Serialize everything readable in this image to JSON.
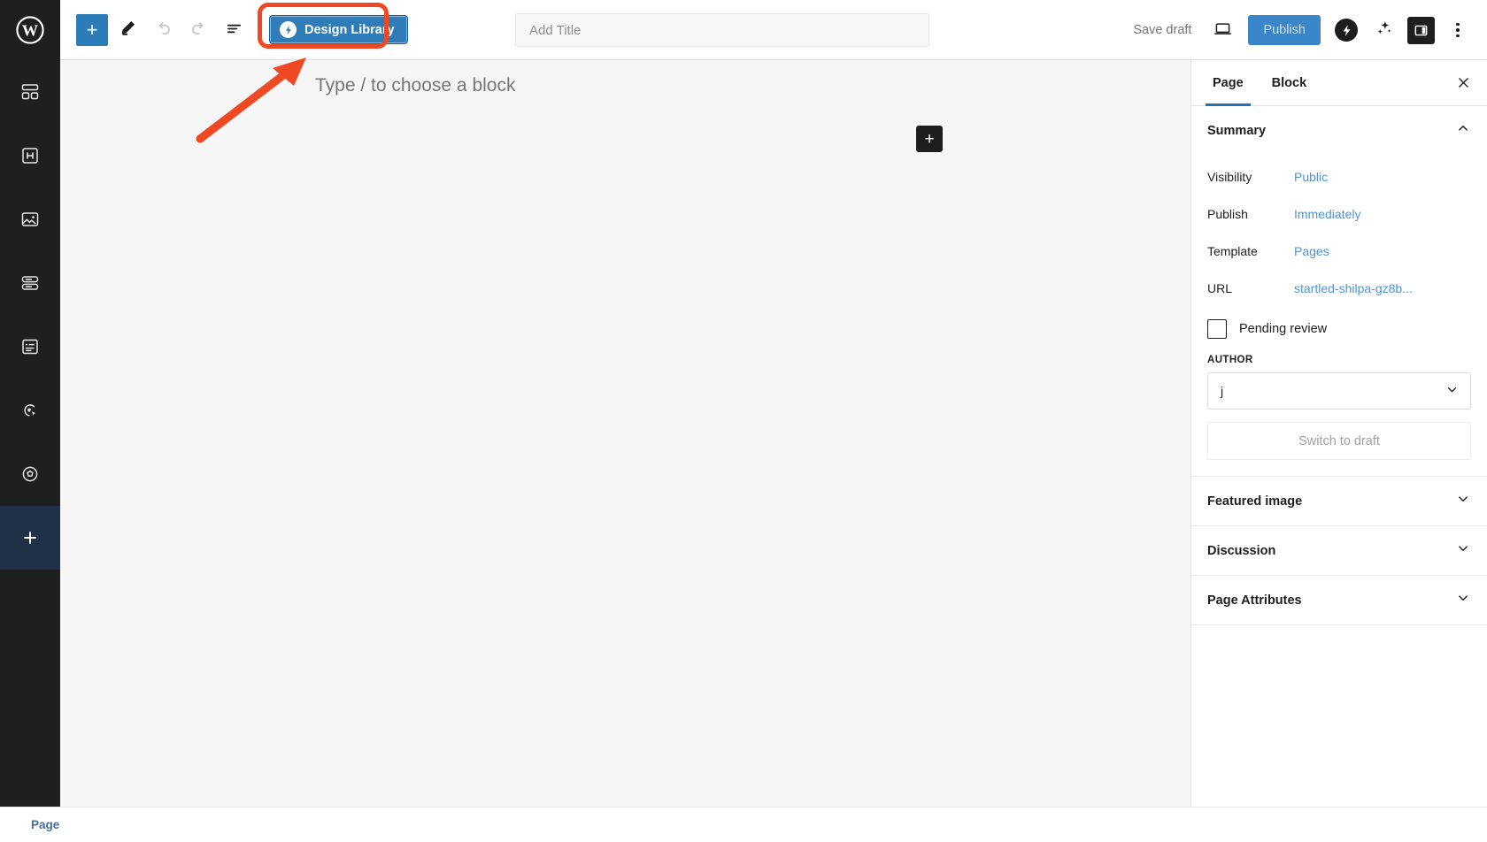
{
  "rail": {
    "logo_icon": "wordpress-logo-icon",
    "items": [
      {
        "icon": "dashboard-layout-icon",
        "name": "rail-item-layout",
        "active": false
      },
      {
        "icon": "header-h-icon",
        "name": "rail-item-header",
        "active": false
      },
      {
        "icon": "image-media-icon",
        "name": "rail-item-media",
        "active": false
      },
      {
        "icon": "stacked-rows-icon",
        "name": "rail-item-rows",
        "active": false
      },
      {
        "icon": "document-text-icon",
        "name": "rail-item-document",
        "active": false
      },
      {
        "icon": "cursor-target-icon",
        "name": "rail-item-interaction",
        "active": false
      },
      {
        "icon": "settings-gear-circle-icon",
        "name": "rail-item-settings",
        "active": false
      },
      {
        "icon": "plus-icon",
        "name": "rail-item-add",
        "active": true
      }
    ]
  },
  "toolbar": {
    "add_block_icon": "plus-icon",
    "edit_tool_icon": "pencil-icon",
    "undo_icon": "undo-arrow-icon",
    "redo_icon": "redo-arrow-icon",
    "list_view_icon": "list-view-icon",
    "design_library_label": "Design Library",
    "design_library_icon": "lightning-bolt-icon",
    "save_draft_label": "Save draft",
    "preview_icon": "desktop-preview-icon",
    "publish_label": "Publish",
    "plugin_bolt_icon": "lightning-bolt-dark-icon",
    "ai_sparkle_icon": "sparkles-icon",
    "sidebar_toggle_icon": "sidebar-panel-icon",
    "options_icon": "three-dots-vertical-icon"
  },
  "title_field": {
    "value": "",
    "placeholder": "Add Title"
  },
  "canvas": {
    "block_prompt": "Type / to choose a block",
    "inserter_icon": "plus-icon"
  },
  "annotation": {
    "arrow_color": "#ef4923",
    "highlight_color": "#ef4923",
    "target": "Design Library"
  },
  "sidebar": {
    "tabs": [
      {
        "label": "Page",
        "active": true
      },
      {
        "label": "Block",
        "active": false
      }
    ],
    "close_icon": "close-x-icon",
    "summary": {
      "title": "Summary",
      "chevron_icon": "chevron-up-icon",
      "rows": [
        {
          "label": "Visibility",
          "value": "Public"
        },
        {
          "label": "Publish",
          "value": "Immediately"
        },
        {
          "label": "Template",
          "value": "Pages"
        },
        {
          "label": "URL",
          "value": "startled-shilpa-gz8b..."
        }
      ],
      "pending_review": {
        "label": "Pending review",
        "checked": false,
        "checkbox_icon": "checkbox-unchecked-icon"
      },
      "author": {
        "label": "AUTHOR",
        "value": "j",
        "chevron_icon": "chevron-down-icon"
      },
      "switch_to_draft_label": "Switch to draft"
    },
    "panels": [
      {
        "label": "Featured image",
        "chevron_icon": "chevron-down-icon"
      },
      {
        "label": "Discussion",
        "chevron_icon": "chevron-down-icon"
      },
      {
        "label": "Page Attributes",
        "chevron_icon": "chevron-down-icon"
      }
    ]
  },
  "bottombar": {
    "breadcrumb": "Page"
  },
  "colors": {
    "accent_blue": "#2271b1",
    "button_blue": "#2e7cb8",
    "publish_blue": "#3a86c8",
    "link_blue": "#4f94d4",
    "annotation_orange": "#ef4923",
    "rail_dark": "#1d1f20",
    "canvas_gray": "#f6f6f6"
  }
}
